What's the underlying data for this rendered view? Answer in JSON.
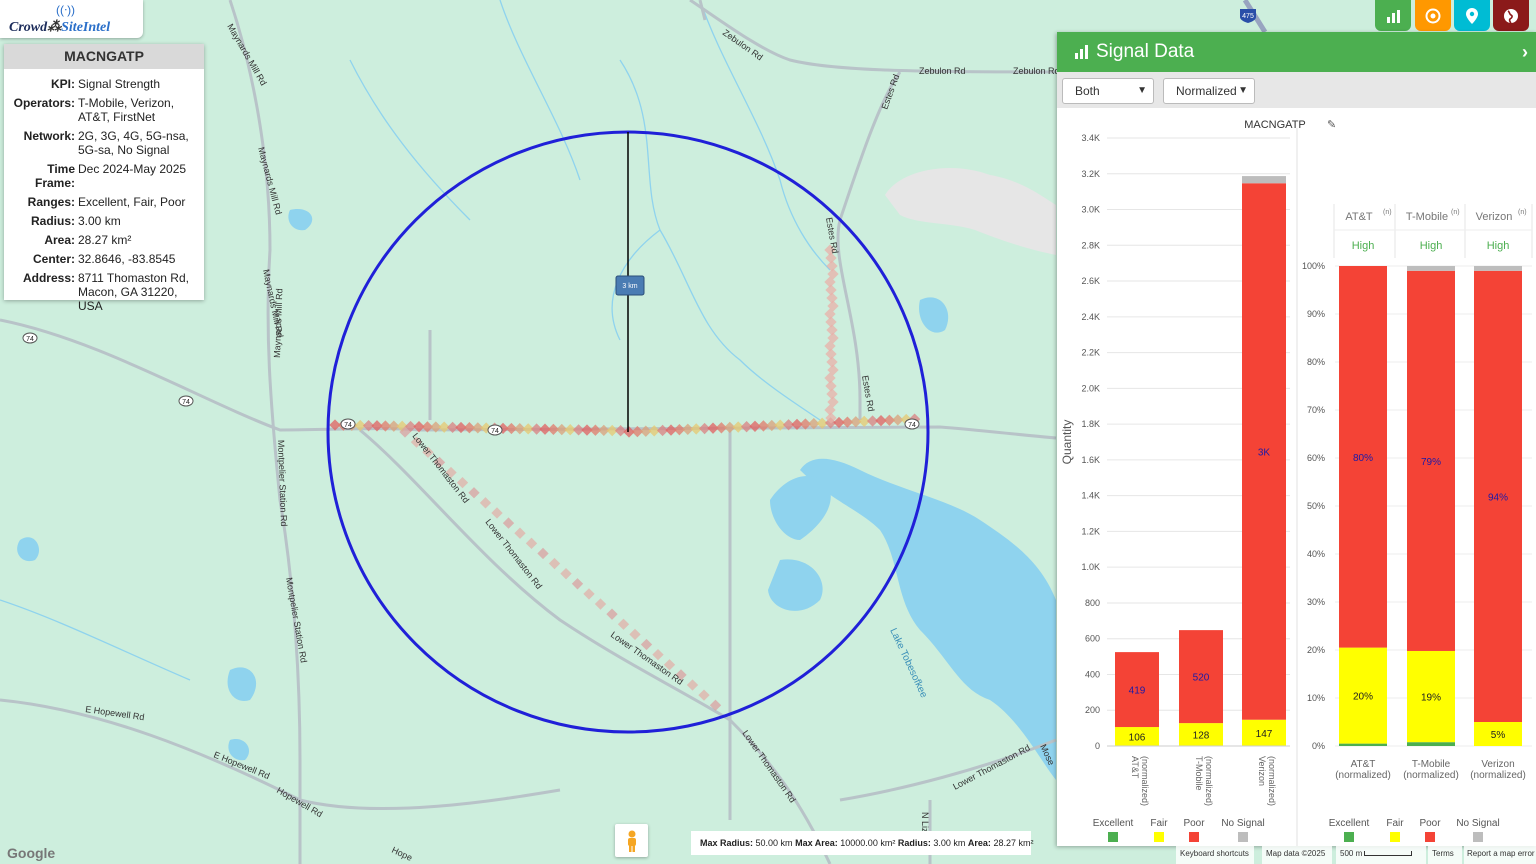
{
  "app": {
    "name_part1": "Crowd",
    "name_part2": "SiteIntel"
  },
  "info": {
    "title": "MACNGATP",
    "rows": [
      {
        "k": "KPI:",
        "v": "Signal Strength"
      },
      {
        "k": "Operators:",
        "v": "T-Mobile, Verizon, AT&T, FirstNet"
      },
      {
        "k": "Network:",
        "v": "2G, 3G, 4G, 5G-nsa, 5G-sa, No Signal"
      },
      {
        "k": "Time Frame:",
        "v": "Dec 2024-May 2025"
      },
      {
        "k": "Ranges:",
        "v": "Excellent, Fair, Poor"
      },
      {
        "k": "Radius:",
        "v": "3.00 km"
      },
      {
        "k": "Area:",
        "v": "28.27 km²"
      },
      {
        "k": "Center:",
        "v": "32.8646, -83.8545"
      },
      {
        "k": "Address:",
        "v": "8711 Thomaston Rd, Macon, GA 31220, USA"
      }
    ]
  },
  "toolbar": {
    "buttons": [
      {
        "name": "chart-icon",
        "color": "#4caf50"
      },
      {
        "name": "target-icon",
        "color": "#ff9800"
      },
      {
        "name": "location-pin-icon",
        "color": "#00bcd4"
      },
      {
        "name": "globe-icon",
        "color": "#8b1a1a"
      }
    ]
  },
  "panel": {
    "title": "Signal Data",
    "select_mode": "Both",
    "select_norm": "Normalized"
  },
  "colors": {
    "excellent": "#4caf50",
    "fair": "#ffff00",
    "poor": "#f44336",
    "no_signal": "#bdbdbd"
  },
  "chart_data": [
    {
      "type": "bar",
      "title": "MACNGATP",
      "ylabel": "Quantity",
      "ylim": [
        0,
        3400
      ],
      "yticks": [
        "0",
        "200",
        "400",
        "600",
        "800",
        "1.0K",
        "1.2K",
        "1.4K",
        "1.6K",
        "1.8K",
        "2.0K",
        "2.2K",
        "2.4K",
        "2.6K",
        "2.8K",
        "3.0K",
        "3.2K",
        "3.4K"
      ],
      "categories": [
        "AT&T (normalized)",
        "T-Mobile (normalized)",
        "Verizon (normalized)"
      ],
      "series": [
        {
          "name": "Excellent",
          "values": [
            0,
            0,
            0
          ]
        },
        {
          "name": "Fair",
          "values": [
            106,
            128,
            147
          ]
        },
        {
          "name": "Poor",
          "values": [
            419,
            520,
            3000
          ]
        },
        {
          "name": "No Signal",
          "values": [
            0,
            0,
            40
          ]
        }
      ],
      "labels": {
        "Fair": [
          "106",
          "128",
          "147"
        ],
        "Poor": [
          "419",
          "520",
          "3K"
        ]
      },
      "legend": [
        "Excellent",
        "Fair",
        "Poor",
        "No Signal"
      ]
    },
    {
      "type": "bar",
      "ylim": [
        0,
        100
      ],
      "yticks": [
        "0%",
        "10%",
        "20%",
        "30%",
        "40%",
        "50%",
        "60%",
        "70%",
        "80%",
        "90%",
        "100%"
      ],
      "categories": [
        "AT&T (normalized)",
        "T-Mobile (normalized)",
        "Verizon (normalized)"
      ],
      "headers": [
        "AT&T",
        "T-Mobile",
        "Verizon"
      ],
      "header_sup": "(n)",
      "header_level": "High",
      "series": [
        {
          "name": "Excellent",
          "values": [
            0.5,
            0.8,
            0
          ]
        },
        {
          "name": "Fair",
          "values": [
            20,
            19,
            5
          ]
        },
        {
          "name": "Poor",
          "values": [
            79.5,
            79.2,
            94
          ]
        },
        {
          "name": "No Signal",
          "values": [
            0,
            1,
            1
          ]
        }
      ],
      "labels": {
        "Fair": [
          "20%",
          "19%",
          "5%"
        ],
        "Poor": [
          "80%",
          "79%",
          "94%"
        ]
      },
      "legend": [
        "Excellent",
        "Fair",
        "Poor",
        "No Signal"
      ]
    }
  ],
  "map": {
    "radius_label": "3 km",
    "roads": [
      "Zebulon Rd",
      "Zebulon Rd",
      "Zebulon Rd",
      "Estes Rd",
      "Estes Rd",
      "Estes Rd",
      "Maynards Mill Rd",
      "Maynards Mill Rd",
      "Maynards Mill Rd",
      "Maynards Mill Rd",
      "Montpelier Station Rd",
      "Montpelier Station Rd",
      "Lower Thomaston Rd",
      "Lower Thomaston Rd",
      "Lower Thomaston Rd",
      "Lower Thomaston Rd",
      "Lower Thomaston Rd",
      "E Hopewell Rd",
      "E Hopewell Rd",
      "Hopewell Rd",
      "N Liz",
      "Mose",
      "Hope"
    ],
    "lake": "Lake Tobesofkee",
    "shields": [
      "74",
      "74",
      "74",
      "74",
      "74",
      "475"
    ],
    "google": "Google",
    "status": {
      "max_radius_k": "Max Radius:",
      "max_radius_v": "50.00 km",
      "max_area_k": "Max Area:",
      "max_area_v": "10000.00 km²",
      "radius_k": "Radius:",
      "radius_v": "3.00 km",
      "area_k": "Area:",
      "area_v": "28.27 km²"
    },
    "attribution": {
      "shortcuts": "Keyboard shortcuts",
      "data": "Map data ©2025",
      "scale": "500 m",
      "terms": "Terms",
      "report": "Report a map error"
    }
  }
}
